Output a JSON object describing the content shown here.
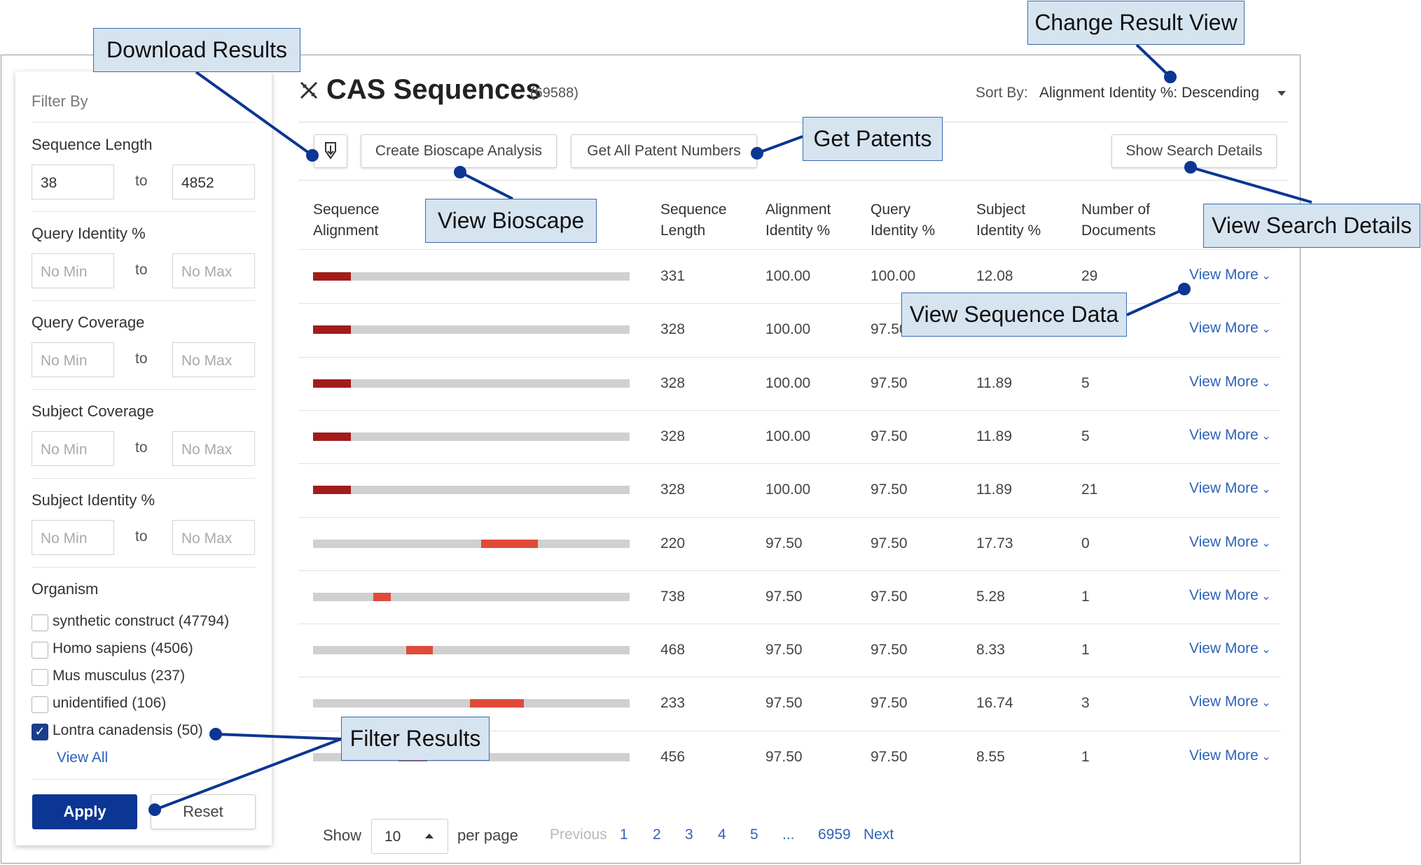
{
  "sidebar": {
    "title": "Filter By",
    "sequence_length": {
      "label": "Sequence Length",
      "min": "38",
      "to": "to",
      "max": "4852"
    },
    "query_identity": {
      "label": "Query Identity %",
      "min_placeholder": "No Min",
      "to": "to",
      "max_placeholder": "No Max"
    },
    "query_coverage": {
      "label": "Query Coverage",
      "min_placeholder": "No Min",
      "to": "to",
      "max_placeholder": "No Max"
    },
    "subject_coverage": {
      "label": "Subject Coverage",
      "min_placeholder": "No Min",
      "to": "to",
      "max_placeholder": "No Max"
    },
    "subject_identity": {
      "label": "Subject Identity %",
      "min_placeholder": "No Min",
      "to": "to",
      "max_placeholder": "No Max"
    },
    "organism": {
      "label": "Organism",
      "items": [
        {
          "label": "synthetic construct (47794)",
          "checked": false
        },
        {
          "label": "Homo sapiens (4506)",
          "checked": false
        },
        {
          "label": "Mus musculus (237)",
          "checked": false
        },
        {
          "label": "unidentified (106)",
          "checked": false
        },
        {
          "label": "Lontra canadensis (50)",
          "checked": true
        }
      ],
      "view_all": "View All"
    },
    "apply_label": "Apply",
    "reset_label": "Reset"
  },
  "header": {
    "title": "CAS Sequences",
    "count": "(69588)",
    "sort_label": "Sort By:",
    "sort_value": "Alignment Identity %: Descending"
  },
  "toolbar": {
    "download_icon": "download-icon",
    "bioscape_label": "Create Bioscape Analysis",
    "patents_label": "Get All Patent Numbers",
    "search_details_label": "Show Search Details"
  },
  "table": {
    "headers": {
      "alignment": [
        "Sequence",
        "Alignment"
      ],
      "length": [
        "Sequence",
        "Length"
      ],
      "alignment_identity": [
        "Alignment",
        "Identity %"
      ],
      "query_identity": [
        "Query",
        "Identity %"
      ],
      "subject_identity": [
        "Subject",
        "Identity %"
      ],
      "documents": [
        "Number of",
        "Documents"
      ]
    },
    "rows": [
      {
        "length": "331",
        "alignment_identity": "100.00",
        "query_identity": "100.00",
        "subject_identity": "12.08",
        "documents": "29",
        "view_more": "View More",
        "seg_start": 0.0,
        "seg_end": 0.12,
        "seg_color": "#a31c1c"
      },
      {
        "length": "328",
        "alignment_identity": "100.00",
        "query_identity": "97.50",
        "subject_identity": "",
        "documents": "",
        "view_more": "View More",
        "seg_start": 0.0,
        "seg_end": 0.12,
        "seg_color": "#a31c1c"
      },
      {
        "length": "328",
        "alignment_identity": "100.00",
        "query_identity": "97.50",
        "subject_identity": "11.89",
        "documents": "5",
        "view_more": "View More",
        "seg_start": 0.0,
        "seg_end": 0.12,
        "seg_color": "#a31c1c"
      },
      {
        "length": "328",
        "alignment_identity": "100.00",
        "query_identity": "97.50",
        "subject_identity": "11.89",
        "documents": "5",
        "view_more": "View More",
        "seg_start": 0.0,
        "seg_end": 0.12,
        "seg_color": "#a31c1c"
      },
      {
        "length": "328",
        "alignment_identity": "100.00",
        "query_identity": "97.50",
        "subject_identity": "11.89",
        "documents": "21",
        "view_more": "View More",
        "seg_start": 0.0,
        "seg_end": 0.12,
        "seg_color": "#a31c1c"
      },
      {
        "length": "220",
        "alignment_identity": "97.50",
        "query_identity": "97.50",
        "subject_identity": "17.73",
        "documents": "0",
        "view_more": "View More",
        "seg_start": 0.53,
        "seg_end": 0.71,
        "seg_color": "#e04a3a"
      },
      {
        "length": "738",
        "alignment_identity": "97.50",
        "query_identity": "97.50",
        "subject_identity": "5.28",
        "documents": "1",
        "view_more": "View More",
        "seg_start": 0.19,
        "seg_end": 0.245,
        "seg_color": "#e04a3a"
      },
      {
        "length": "468",
        "alignment_identity": "97.50",
        "query_identity": "97.50",
        "subject_identity": "8.33",
        "documents": "1",
        "view_more": "View More",
        "seg_start": 0.295,
        "seg_end": 0.38,
        "seg_color": "#e04a3a"
      },
      {
        "length": "233",
        "alignment_identity": "97.50",
        "query_identity": "97.50",
        "subject_identity": "16.74",
        "documents": "3",
        "view_more": "View More",
        "seg_start": 0.495,
        "seg_end": 0.665,
        "seg_color": "#e04a3a"
      },
      {
        "length": "456",
        "alignment_identity": "97.50",
        "query_identity": "97.50",
        "subject_identity": "8.55",
        "documents": "1",
        "view_more": "View More",
        "seg_start": 0.27,
        "seg_end": 0.36,
        "seg_color": "#e04a3a"
      }
    ]
  },
  "pagination": {
    "show_label": "Show",
    "per_page_value": "10",
    "per_page_label": "per page",
    "previous": "Previous",
    "pages": [
      "1",
      "2",
      "3",
      "4",
      "5"
    ],
    "ellipsis": "...",
    "last_page": "6959",
    "next": "Next"
  },
  "callouts": {
    "download_results": "Download Results",
    "change_result_view": "Change Result View",
    "get_patents": "Get Patents",
    "view_bioscape": "View Bioscape",
    "view_search_details": "View Search Details",
    "view_sequence_data": "View Sequence Data",
    "filter_results": "Filter Results"
  },
  "colors": {
    "primary": "#0c3694",
    "link": "#2d63b8",
    "callout_fill": "#d6e4f0",
    "callout_line": "#0c3694",
    "alignment_dark": "#a31c1c",
    "alignment_light": "#e04a3a"
  }
}
